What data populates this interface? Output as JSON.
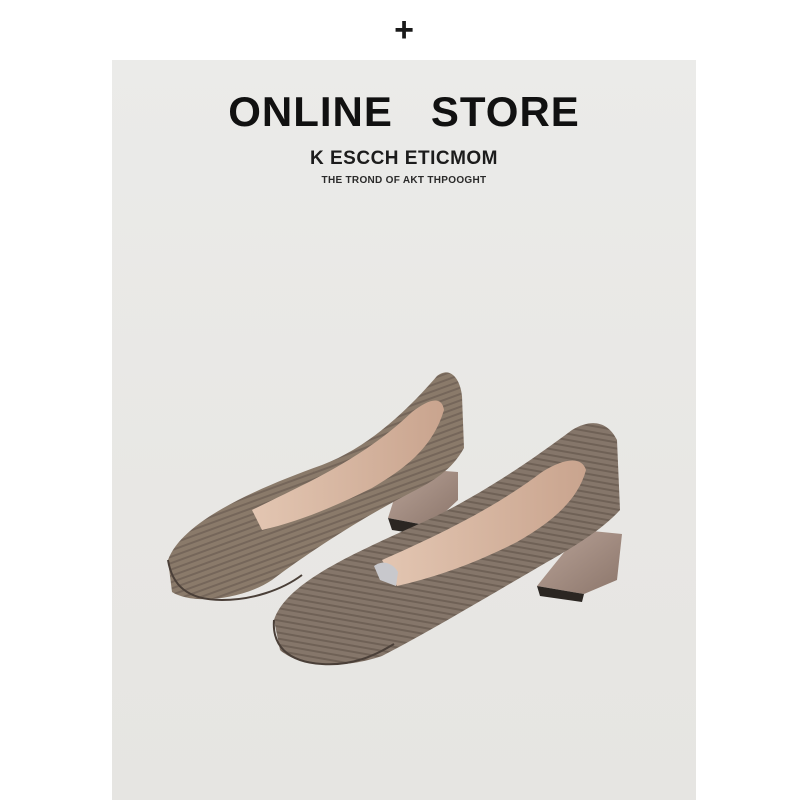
{
  "header": {
    "plus_symbol": "+"
  },
  "banner": {
    "title": "ONLINE   STORE",
    "subtitle": "K ESCCH ETICMOM",
    "tagline": "THE TROND OF AKT THPOOGHT"
  },
  "product_image": {
    "subject": "pair of knitted square-toe pumps",
    "colors": {
      "knit": "#8a7a6a",
      "heel": "#a58f83",
      "insole": "#d8b9a4",
      "background": "#e9e8e5"
    }
  }
}
